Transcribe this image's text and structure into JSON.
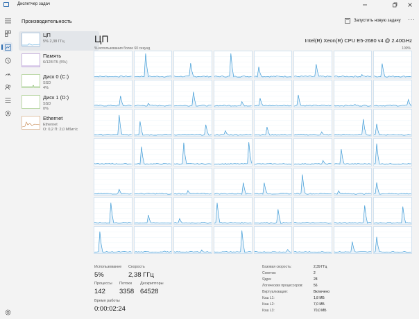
{
  "window": {
    "title": "Диспетчер задач"
  },
  "nav": [
    "hamburger-icon",
    "processes-icon",
    "performance-icon",
    "history-icon",
    "startup-icon",
    "users-icon",
    "details-icon",
    "services-icon",
    "settings-icon"
  ],
  "header": {
    "title": "Производительность",
    "run_task": "Запустить новую задачу",
    "more": "···"
  },
  "devices": [
    {
      "name": "ЦП",
      "lines": [
        "5% 2,38 ГГц"
      ]
    },
    {
      "name": "Память",
      "lines": [
        "6/128 ГБ (5%)"
      ]
    },
    {
      "name": "Диск 0 (C:)",
      "lines": [
        "SSD",
        "4%"
      ]
    },
    {
      "name": "Диск 1 (D:)",
      "lines": [
        "SSD",
        "0%"
      ]
    },
    {
      "name": "Ethernet",
      "lines": [
        "Ethernet",
        "О: 0,2 П: 2,0 Мбит/с"
      ]
    }
  ],
  "cpu": {
    "heading": "ЦП",
    "model": "Intel(R) Xeon(R) CPU E5-2680 v4 @ 2.40GHz",
    "util_label": "% использования более 60 секунд",
    "util_max": "100%",
    "grid_rows": 7,
    "grid_cols": 8,
    "line_color": "#3e9bd6",
    "stats": {
      "utilization_label": "Использование",
      "utilization": "5%",
      "speed_label": "Скорость",
      "speed": "2,38 ГГц",
      "processes_label": "Процессы",
      "processes": "142",
      "threads_label": "Потоки",
      "threads": "3358",
      "handles_label": "Дескрипторы",
      "handles": "64528",
      "uptime_label": "Время работы",
      "uptime": "0:00:02:24"
    },
    "props": [
      {
        "k": "Базовая скорость:",
        "v": "2,39 ГГц"
      },
      {
        "k": "Сокетов:",
        "v": "2"
      },
      {
        "k": "Ядра:",
        "v": "28"
      },
      {
        "k": "Логических процессоров:",
        "v": "56"
      },
      {
        "k": "Виртуализация:",
        "v": "Включено"
      },
      {
        "k": "Кэш L1:",
        "v": "1,8 МБ"
      },
      {
        "k": "Кэш L2:",
        "v": "7,0 МБ"
      },
      {
        "k": "Кэш L3:",
        "v": "70,0 МБ"
      }
    ]
  }
}
